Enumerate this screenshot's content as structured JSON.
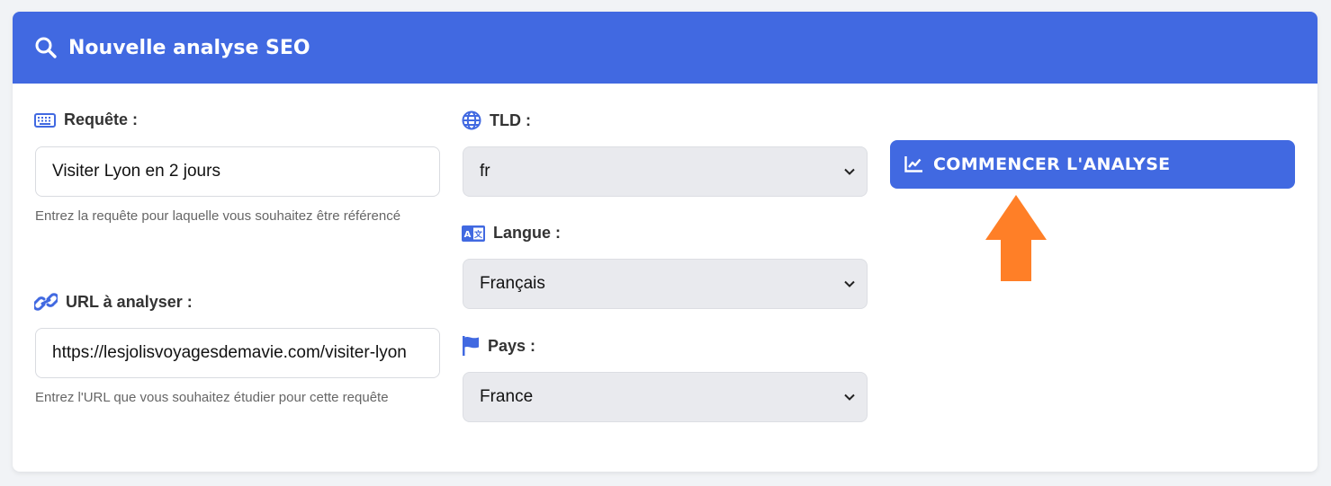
{
  "header": {
    "title": "Nouvelle analyse SEO",
    "icon": "search-icon"
  },
  "query": {
    "label": "Requête :",
    "icon": "keyboard-icon",
    "value": "Visiter Lyon en 2 jours",
    "help": "Entrez la requête pour laquelle vous souhaitez être référencé"
  },
  "url": {
    "label": "URL à analyser :",
    "icon": "link-icon",
    "value": "https://lesjolisvoyagesdemavie.com/visiter-lyon",
    "help": "Entrez l'URL que vous souhaitez étudier pour cette requête"
  },
  "tld": {
    "label": "TLD :",
    "icon": "globe-icon",
    "value": "fr"
  },
  "language": {
    "label": "Langue :",
    "icon": "translate-icon",
    "value": "Français"
  },
  "country": {
    "label": "Pays :",
    "icon": "flag-icon",
    "value": "France"
  },
  "start_button": {
    "label": "COMMENCER L'ANALYSE",
    "icon": "chart-line-icon"
  },
  "colors": {
    "primary": "#4169e1",
    "arrow": "#ff7f27",
    "select_bg": "#e9eaee"
  }
}
